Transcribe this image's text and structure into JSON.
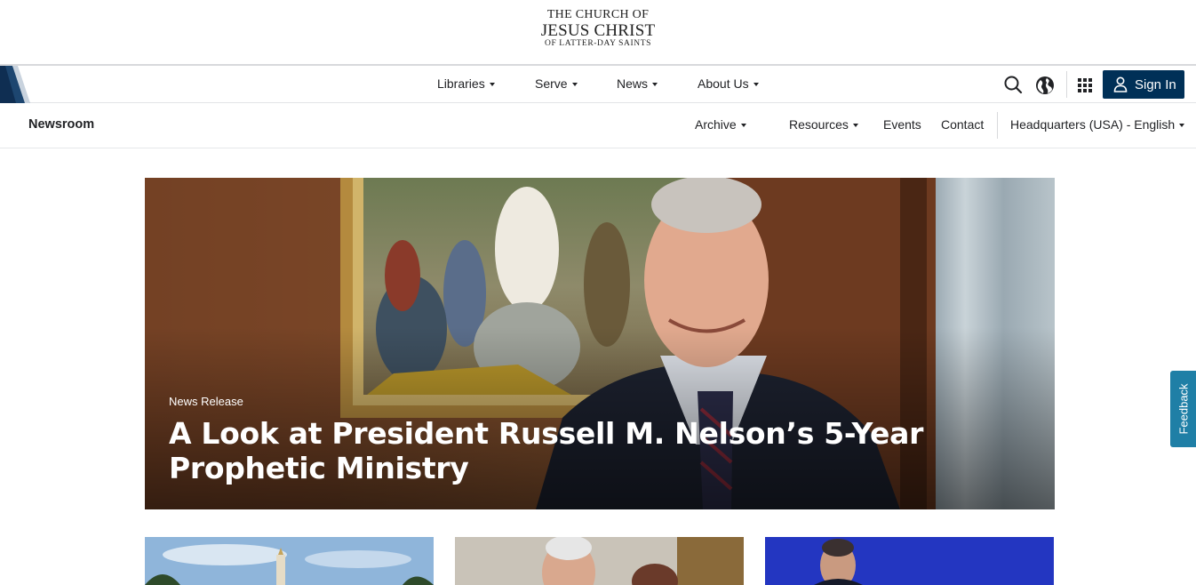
{
  "logo": {
    "line1": "THE CHURCH OF",
    "line2": "JESUS CHRIST",
    "line3": "OF LATTER-DAY SAINTS"
  },
  "main_nav": {
    "items": [
      {
        "label": "Libraries"
      },
      {
        "label": "Serve"
      },
      {
        "label": "News"
      },
      {
        "label": "About Us"
      }
    ],
    "search_icon": "search-icon",
    "globe_icon": "globe-icon",
    "apps_icon": "grid-apps-icon",
    "sign_in": "Sign In",
    "brand_color": "#003057"
  },
  "sub_nav": {
    "title": "Newsroom",
    "items": [
      {
        "label": "Archive",
        "dropdown": true
      },
      {
        "label": "Resources",
        "dropdown": true
      },
      {
        "label": "Events",
        "dropdown": false
      },
      {
        "label": "Contact",
        "dropdown": false
      }
    ],
    "locale": "Headquarters (USA) - English"
  },
  "hero": {
    "tag": "News Release",
    "title": "A Look at President Russell M. Nelson’s 5-Year Prophetic Ministry"
  },
  "cards": [
    {
      "image": "temple-photo"
    },
    {
      "image": "couple-photo"
    },
    {
      "image": "speaker-photo"
    }
  ],
  "feedback": {
    "label": "Feedback",
    "color": "#1f7fa6"
  }
}
